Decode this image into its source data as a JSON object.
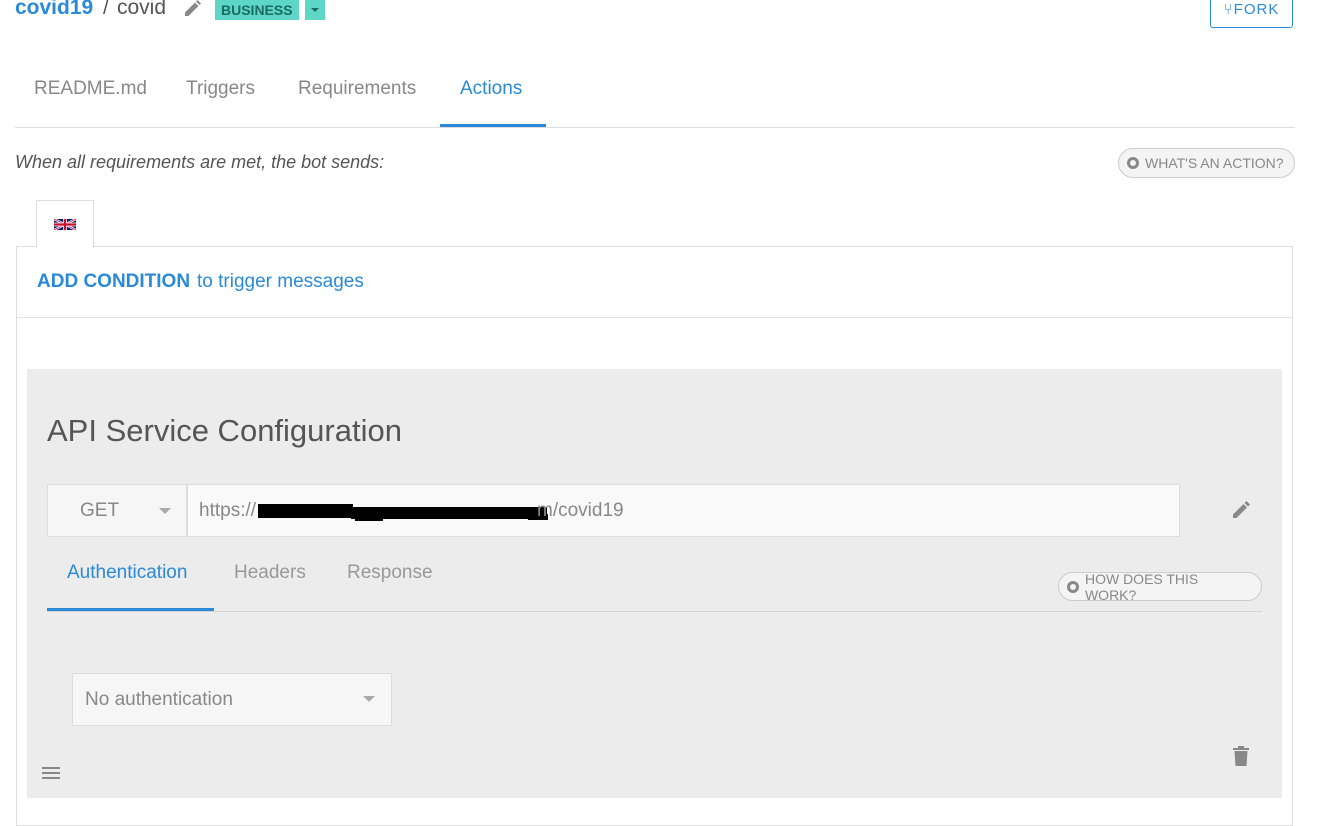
{
  "header": {
    "owner": "covid19",
    "separator": "/",
    "repo": "covid",
    "badge": "BUSINESS",
    "fork_label": "FORK"
  },
  "tabs": [
    {
      "label": "README.md"
    },
    {
      "label": "Triggers"
    },
    {
      "label": "Requirements"
    },
    {
      "label": "Actions",
      "active": true
    }
  ],
  "actions": {
    "description": "When all requirements are met, the bot sends:",
    "help_label": "WHAT'S AN ACTION?",
    "language": "en-GB-flag-icon",
    "add_condition": "ADD CONDITION",
    "add_condition_tail": "to trigger messages"
  },
  "api": {
    "title": "API Service Configuration",
    "method": "GET",
    "url_prefix": "https://",
    "url_suffix": "m/covid19",
    "subtabs": [
      {
        "label": "Authentication",
        "active": true
      },
      {
        "label": "Headers"
      },
      {
        "label": "Response"
      }
    ],
    "help_label": "HOW DOES THIS WORK?",
    "auth_value": "No authentication"
  },
  "colors": {
    "accent": "#2b8ad8",
    "badge_bg": "#5dd6c8",
    "panel_bg": "#ececec"
  }
}
